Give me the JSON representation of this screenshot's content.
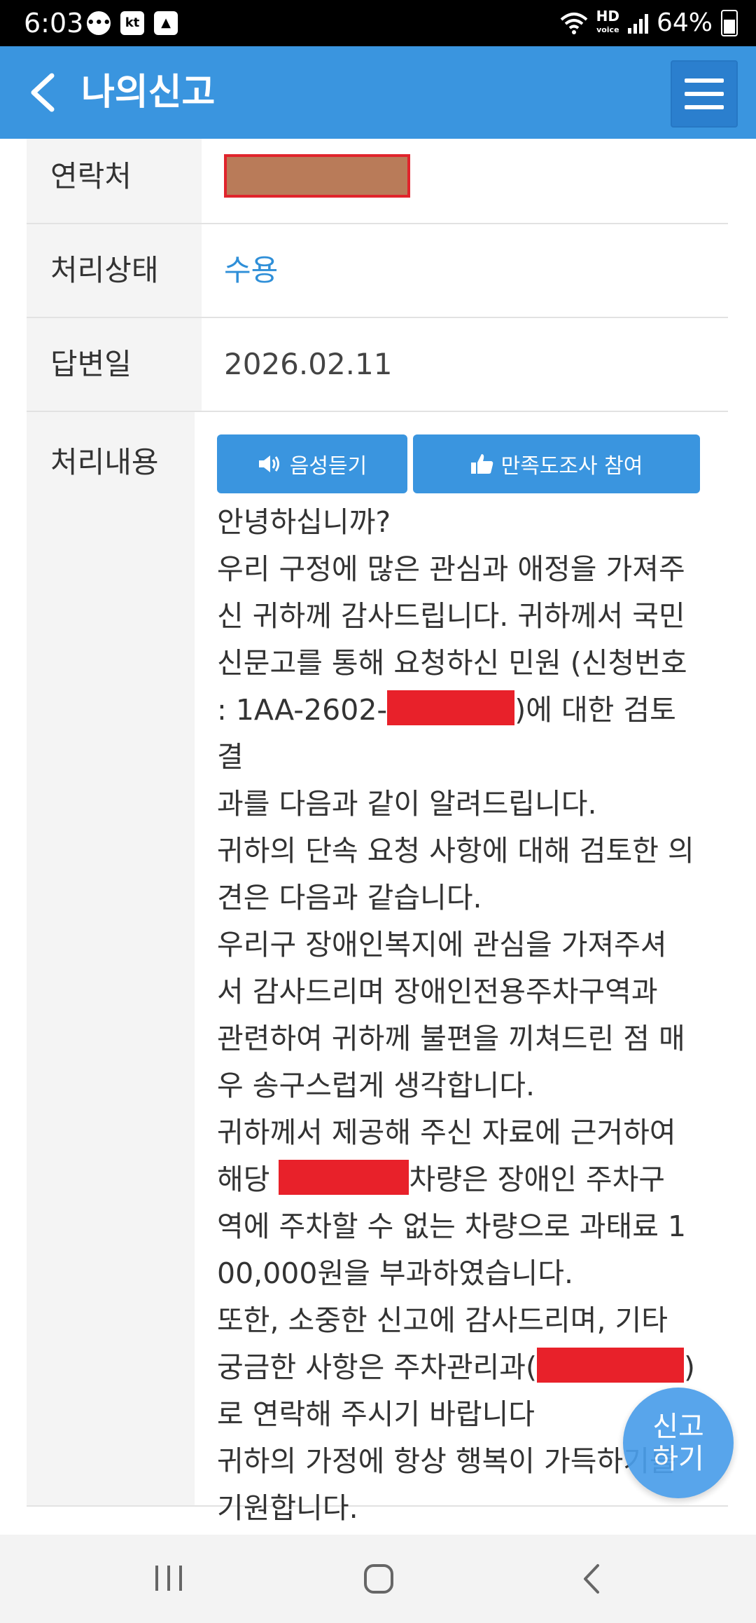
{
  "status_bar": {
    "time": "6:03",
    "kt_label": "kt",
    "hd_label": "HD",
    "voice_label": "voice",
    "battery": "64%"
  },
  "header": {
    "title": "나의신고"
  },
  "rows": {
    "contact": {
      "label": "연락처"
    },
    "status": {
      "label": "처리상태",
      "value": "수용"
    },
    "date": {
      "label": "답변일",
      "value": "2026.02.11"
    },
    "content": {
      "label": "처리내용",
      "voice_button": "음성듣기",
      "survey_button": "만족도조사 참여",
      "lines": [
        "안녕하십니까?",
        "우리 구정에 많은 관심과 애정을 가져주",
        "신 귀하께 감사드립니다. 귀하께서 국민",
        "신문고를 통해 요청하신 민원 (신청번호",
        ": 1AA-2602-",
        ")에 대한 검토 결",
        "과를 다음과 같이 알려드립니다.",
        "귀하의 단속 요청 사항에 대해 검토한 의",
        "견은 다음과 같습니다.",
        "우리구 장애인복지에 관심을 가져주셔",
        "서 감사드리며 장애인전용주차구역과",
        "관련하여 귀하께 불편을 끼쳐드린 점 매",
        "우 송구스럽게 생각합니다.",
        "귀하께서 제공해 주신 자료에 근거하여",
        "해당 ",
        "차량은 장애인 주차구",
        "역에 주차할 수 없는 차량으로 과태료 1",
        "00,000원을 부과하였습니다.",
        "또한, 소중한 신고에 감사드리며, 기타",
        "궁금한 사항은 주차관리과(",
        ")",
        "로 연락해 주시기 바랍니다",
        "귀하의 가정에 항상 행복이 가득하기를",
        "기원합니다."
      ]
    }
  },
  "fab": {
    "line1": "신고",
    "line2": "하기"
  },
  "colors": {
    "header": "#3a95df",
    "accent": "#2f8fd8",
    "redaction": "#e8212a"
  }
}
